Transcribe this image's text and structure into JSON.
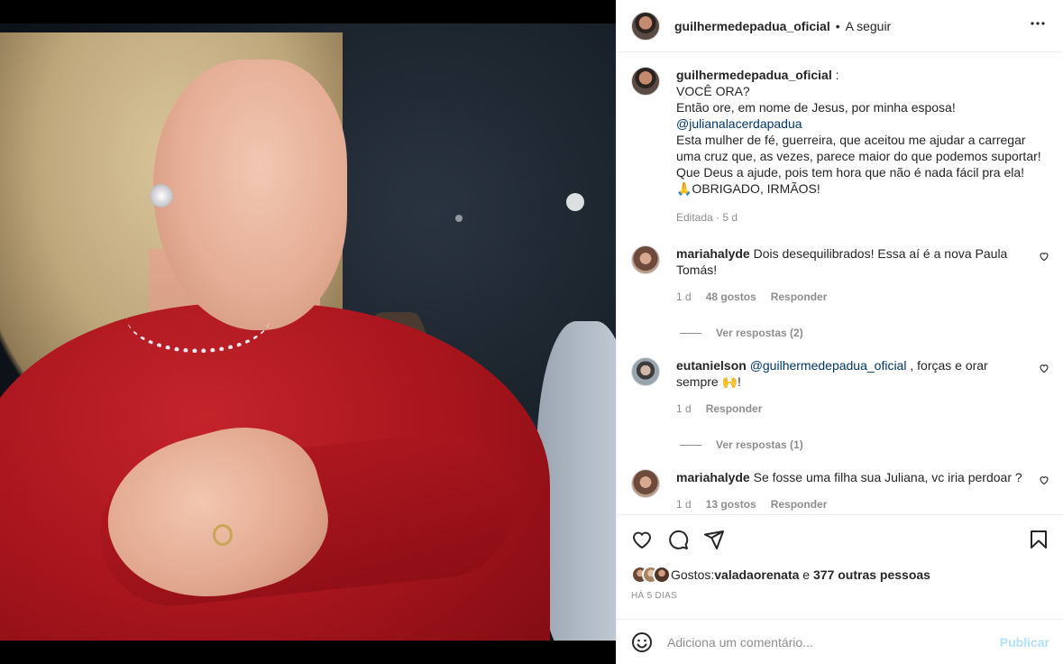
{
  "post": {
    "username": "guilhermedepadua_oficial",
    "separator": "•",
    "follow_label": "A seguir",
    "more_icon": "more-horizontal-icon"
  },
  "caption": {
    "username": "guilhermedepadua_oficial",
    "colon": " :",
    "line1": "VOCÊ ORA?",
    "line2": "Então ore, em nome de Jesus, por minha esposa!",
    "mention": "@julianalacerdapadua",
    "line3": "Esta mulher de fé, guerreira, que aceitou me ajudar a carregar uma cruz que, as vezes, parece maior do que podemos suportar! Que Deus a ajude, pois tem hora que não é nada fácil pra ela!",
    "line4": "🙏OBRIGADO, IRMÃOS!",
    "meta": "Editada · 5 d"
  },
  "comments": [
    {
      "username": "mariahalyde",
      "text": "Dois desequilibrados! Essa aí é a nova Paula Tomás!",
      "time": "1 d",
      "likes": "48 gostos",
      "reply": "Responder",
      "view_replies": "Ver respostas (2)"
    },
    {
      "username": "eutanielson",
      "mention": "@guilhermedepadua_oficial",
      "text": " , forças e orar sempre 🙌!",
      "time": "1 d",
      "reply": "Responder",
      "view_replies": "Ver respostas (1)"
    },
    {
      "username": "mariahalyde",
      "text": "Se fosse uma filha sua Juliana, vc iria perdoar ?",
      "time": "1 d",
      "likes": "13 gostos",
      "reply": "Responder"
    }
  ],
  "actions": {
    "like_icon": "heart-icon",
    "comment_icon": "comment-icon",
    "share_icon": "send-icon",
    "save_icon": "bookmark-icon",
    "likes_prefix": "Gostos: ",
    "likes_user": "valadaorenata",
    "likes_connector": " e ",
    "likes_others": "377 outras pessoas",
    "timestamp": "HÁ 5 DIAS"
  },
  "add_comment": {
    "placeholder": "Adiciona um comentário...",
    "publish_label": "Publicar",
    "emoji_icon": "smiley-icon"
  },
  "colors": {
    "text": "#262626",
    "secondary": "#8e8e8e",
    "mention": "#00376b",
    "publish_disabled": "#b2dffc"
  }
}
